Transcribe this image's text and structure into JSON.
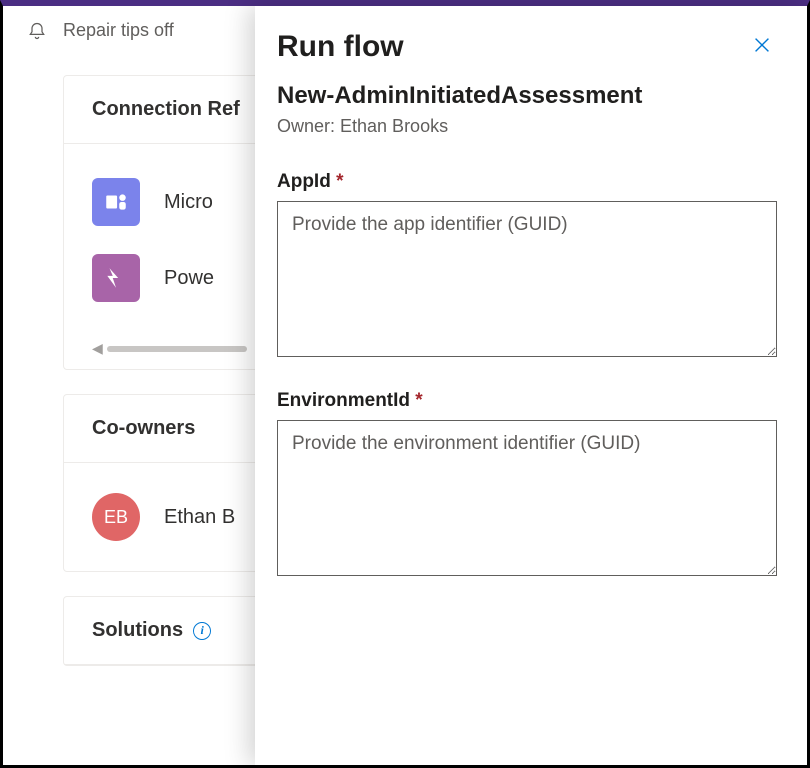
{
  "repair_tips": {
    "label": "Repair tips off"
  },
  "cards": {
    "connection_refs": {
      "title": "Connection Ref",
      "items": [
        {
          "label": "Micro"
        },
        {
          "label": "Powe"
        }
      ]
    },
    "co_owners": {
      "title": "Co-owners",
      "owner": {
        "initials": "EB",
        "name": "Ethan B"
      }
    },
    "solutions": {
      "title": "Solutions"
    }
  },
  "panel": {
    "title": "Run flow",
    "flow_name": "New-AdminInitiatedAssessment",
    "owner_label": "Owner: Ethan Brooks",
    "fields": {
      "appId": {
        "label": "AppId",
        "placeholder": "Provide the app identifier (GUID)"
      },
      "envId": {
        "label": "EnvironmentId",
        "placeholder": "Provide the environment identifier (GUID)"
      }
    },
    "required_mark": "*"
  }
}
